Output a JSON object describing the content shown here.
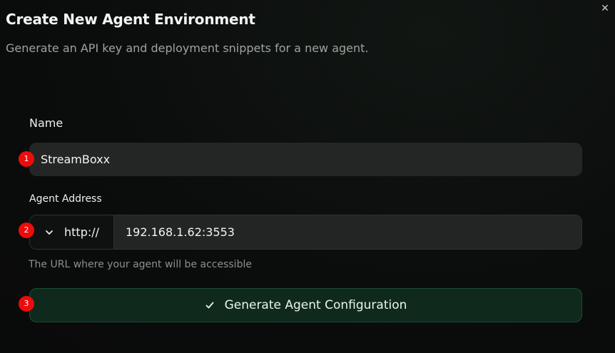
{
  "dialog": {
    "title": "Create New Agent Environment",
    "subtitle": "Generate an API key and deployment snippets for a new agent.",
    "close_icon": "close-icon"
  },
  "form": {
    "name_label": "Name",
    "name_value": "StreamBoxx",
    "address_label": "Agent Address",
    "protocol": "http://",
    "address_value": "192.168.1.62:3553",
    "address_helper": "The URL where your agent will be accessible",
    "submit_label": "Generate Agent Configuration",
    "submit_icon": "check-icon",
    "protocol_icon": "chevron-down-icon"
  },
  "markers": [
    "1",
    "2",
    "3"
  ],
  "colors": {
    "background": "#0b0d0c",
    "input_bg": "#242626",
    "button_bg": "#0f2a1c",
    "button_border": "#1d4a32",
    "marker": "#ee0b0b"
  }
}
